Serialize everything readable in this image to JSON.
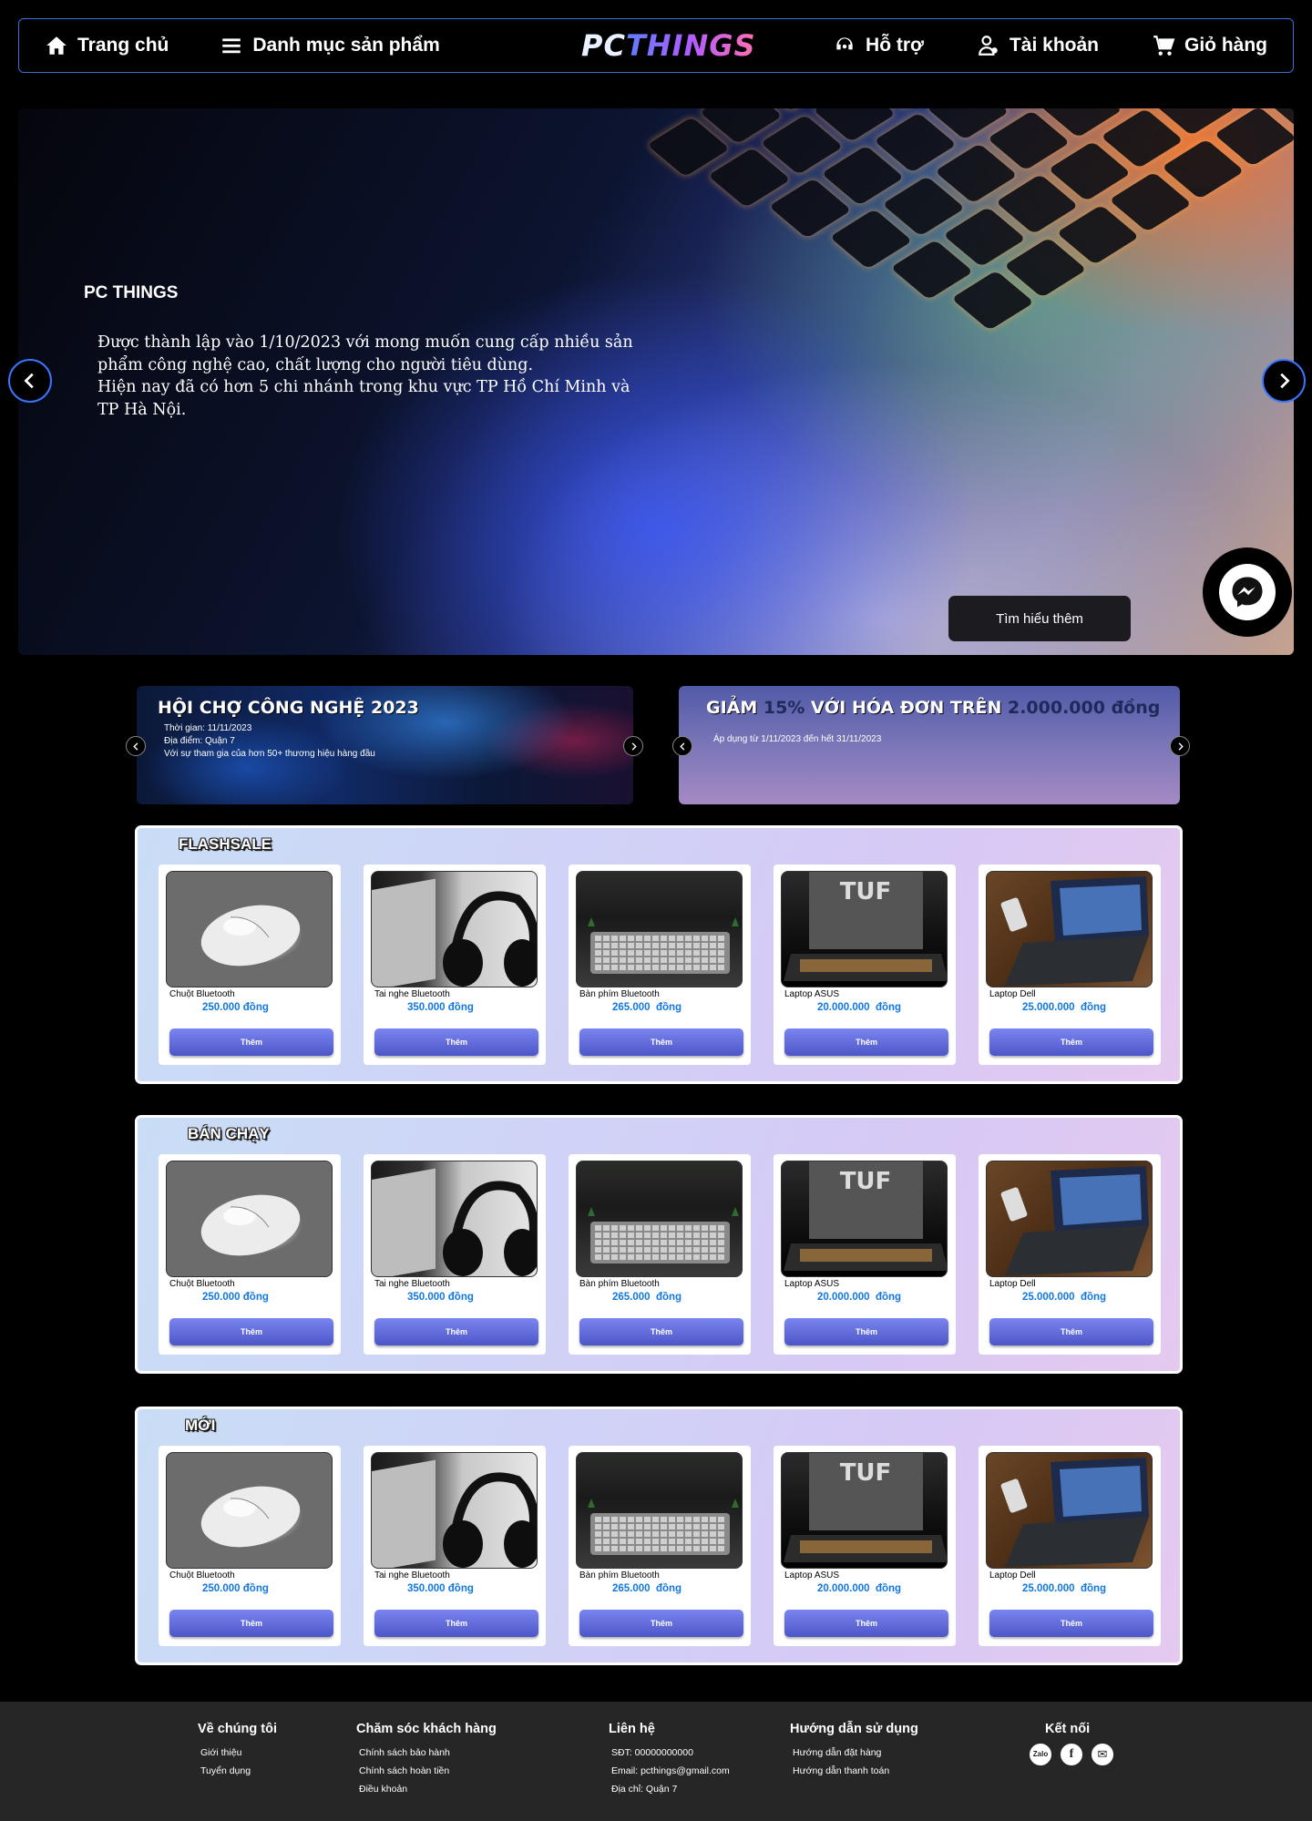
{
  "nav": {
    "home": "Trang chủ",
    "categories": "Danh mục sản phẩm",
    "logo_pc": "PC",
    "logo_things": "THINGS",
    "support": "Hỗ trợ",
    "account": "Tài khoản",
    "cart": "Giỏ hàng"
  },
  "hero": {
    "title": "PC THINGS",
    "line1": "Được thành lập vào 1/10/2023 với mong muốn cung cấp nhiều sản phẩm công nghệ cao, chất lượng cho người tiêu dùng.",
    "line2": "Hiện nay đã có hơn 5 chi nhánh trong khu vực TP Hồ Chí Minh và TP Hà Nội.",
    "button": "Tìm hiểu thêm"
  },
  "promos": [
    {
      "title": "HỘI CHỢ CÔNG NGHỆ 2023",
      "time": "Thời gian: 11/11/2023",
      "place": "Địa điểm: Quận 7",
      "desc": "Với sự tham gia của hơn 50+ thương hiệu hàng đầu"
    },
    {
      "title_a": "GIẢM ",
      "title_b": "15%",
      "title_c": " VỚI HÓA ĐƠN TRÊN ",
      "title_d": "2.000.000",
      "title_e": " đồng",
      "desc": "Áp dụng từ 1/11/2023 đến hết 31/11/2023"
    }
  ],
  "sections": [
    {
      "title": "FLASHSALE",
      "products": [
        {
          "name": "Chuột Bluetooth",
          "price": "250.000 đồng",
          "button": "Thêm",
          "image": "mouse"
        },
        {
          "name": "Tai nghe Bluetooth",
          "price": "350.000 đồng",
          "button": "Thêm",
          "image": "headphone"
        },
        {
          "name": "Bàn phím Bluetooth",
          "price": "265.000  đồng",
          "button": "Thêm",
          "image": "keyboard"
        },
        {
          "name": "Laptop ASUS",
          "price": "20.000.000  đồng",
          "button": "Thêm",
          "image": "laptop-asus"
        },
        {
          "name": "Laptop Dell",
          "price": "25.000.000  đồng",
          "button": "Thêm",
          "image": "laptop-dell"
        }
      ]
    },
    {
      "title": "BÁN CHẠY",
      "products": [
        {
          "name": "Chuột Bluetooth",
          "price": "250.000 đồng",
          "button": "Thêm",
          "image": "mouse"
        },
        {
          "name": "Tai nghe Bluetooth",
          "price": "350.000 đồng",
          "button": "Thêm",
          "image": "headphone"
        },
        {
          "name": "Bàn phím Bluetooth",
          "price": "265.000  đồng",
          "button": "Thêm",
          "image": "keyboard"
        },
        {
          "name": "Laptop ASUS",
          "price": "20.000.000  đồng",
          "button": "Thêm",
          "image": "laptop-asus"
        },
        {
          "name": "Laptop Dell",
          "price": "25.000.000  đồng",
          "button": "Thêm",
          "image": "laptop-dell"
        }
      ]
    },
    {
      "title": "MỚI",
      "products": [
        {
          "name": "Chuột Bluetooth",
          "price": "250.000 đồng",
          "button": "Thêm",
          "image": "mouse"
        },
        {
          "name": "Tai nghe Bluetooth",
          "price": "350.000 đồng",
          "button": "Thêm",
          "image": "headphone"
        },
        {
          "name": "Bàn phím Bluetooth",
          "price": "265.000  đồng",
          "button": "Thêm",
          "image": "keyboard"
        },
        {
          "name": "Laptop ASUS",
          "price": "20.000.000  đồng",
          "button": "Thêm",
          "image": "laptop-asus"
        },
        {
          "name": "Laptop Dell",
          "price": "25.000.000  đồng",
          "button": "Thêm",
          "image": "laptop-dell"
        }
      ]
    }
  ],
  "footer": {
    "about": {
      "title": "Về chúng tôi",
      "items": [
        "Giới thiệu",
        "Tuyển dụng"
      ]
    },
    "care": {
      "title": "Chăm sóc khách hàng",
      "items": [
        "Chính sách bảo hành",
        "Chính sách hoàn tiền",
        "Điều khoản"
      ]
    },
    "contact": {
      "title": "Liên hệ",
      "items": [
        "SĐT: 00000000000",
        "Email: pcthings@gmail.com",
        "Địa chỉ: Quận 7"
      ]
    },
    "guide": {
      "title": "Hướng dẫn sử dụng",
      "items": [
        "Hướng dẫn đặt hàng",
        "Hướng dẫn thanh toán"
      ]
    },
    "connect": {
      "title": "Kết nối",
      "zalo": "Zalo",
      "facebook": "f",
      "email_icon": "✉"
    }
  },
  "colors": {
    "nav_border": "#3d6fd6",
    "price": "#1278e0",
    "add_button": "#5a63d8",
    "footer_bg": "#262626"
  },
  "icons": [
    "home-icon",
    "menu-icon",
    "support-icon",
    "account-icon",
    "cart-icon",
    "chevron-left-icon",
    "chevron-right-icon",
    "messenger-icon",
    "zalo-icon",
    "facebook-icon",
    "mail-icon"
  ]
}
